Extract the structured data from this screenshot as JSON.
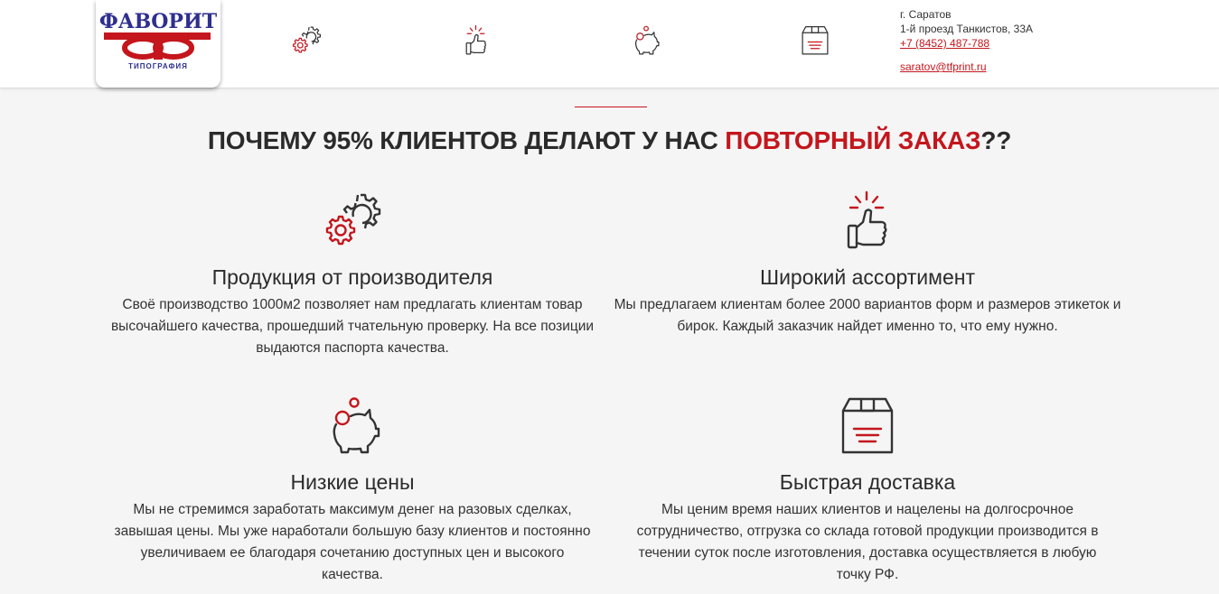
{
  "colors": {
    "accent": "#c4161c",
    "dark": "#2b2b2b",
    "logo_blue": "#2e2f8f"
  },
  "logo": {
    "name": "ФАВОРИТ",
    "sub": "ТИПОГРАФИЯ"
  },
  "header": {
    "icons": [
      "gears-icon",
      "thumbs-up-icon",
      "piggy-bank-icon",
      "box-icon"
    ],
    "contacts": {
      "city": "г. Саратов",
      "address": "1-й проезд Танкистов, 33А",
      "phone": "+7 (8452) 487-788",
      "email": "saratov@tfprint.ru"
    }
  },
  "title": {
    "part1": "ПОЧЕМУ 95% КЛИЕНТОВ ДЕЛАЮТ У НАС ",
    "accent": "ПОВТОРНЫЙ ЗАКАЗ",
    "part2": "??"
  },
  "features": [
    {
      "icon": "gears-icon",
      "heading": "Продукция от производителя",
      "text": "Своё производство 1000м2 позволяет нам предлагать клиентам товар высочайшего качества, прошедший тчательную проверку. На все позиции выдаются паспорта качества."
    },
    {
      "icon": "thumbs-up-icon",
      "heading": "Широкий ассортимент",
      "text": "Мы предлагаем клиентам более 2000 вариантов форм и размеров этикеток и бирок. Каждый заказчик найдет именно то, что ему нужно."
    },
    {
      "icon": "piggy-bank-icon",
      "heading": "Низкие цены",
      "text": "Мы не стремимся заработать максимум денег на разовых сделках, завышая цены. Мы уже наработали большую базу клиентов и постоянно увеличиваем ее благодаря сочетанию доступных цен и высокого качества."
    },
    {
      "icon": "box-icon",
      "heading": "Быстрая доставка",
      "text": "Мы ценим время наших клиентов и нацелены на долгосрочное сотрудничество, отгрузка со склада готовой продукции производится в течении суток после изготовления, доставка осуществляется в любую точку РФ."
    }
  ]
}
